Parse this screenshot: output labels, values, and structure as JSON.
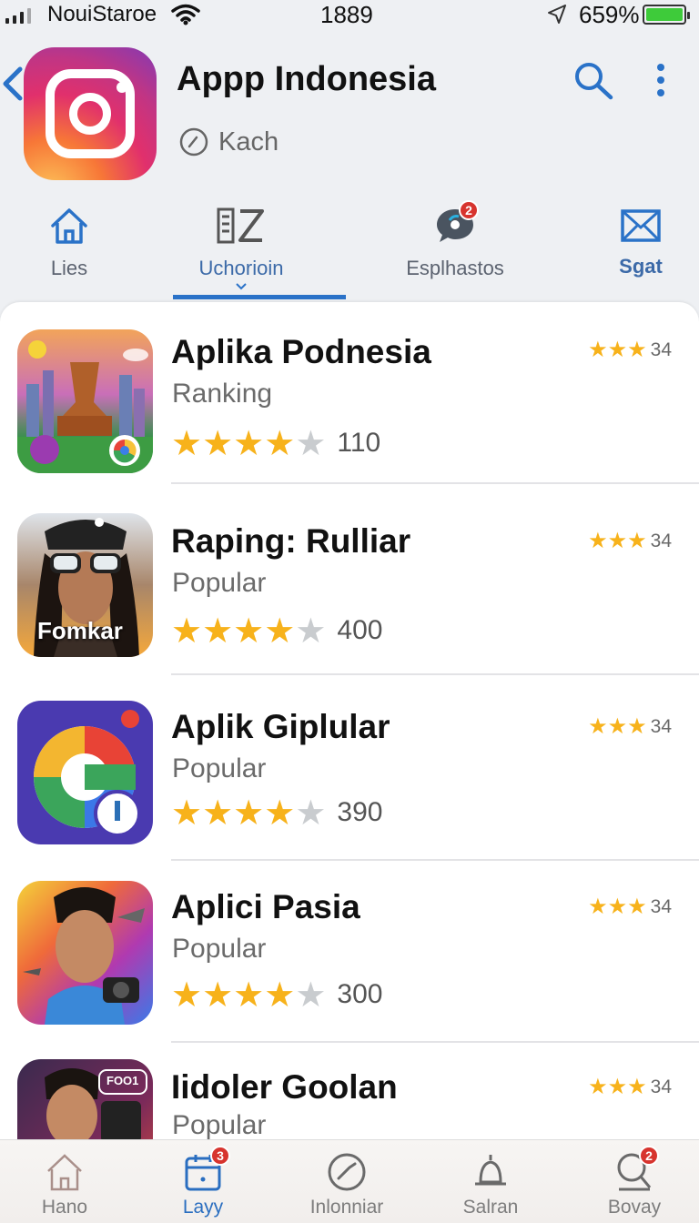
{
  "status_bar": {
    "carrier": "NouiStaroe",
    "time": "1889",
    "battery_percent": "659%",
    "battery_level": 1.0
  },
  "header": {
    "title": "Appp Indonesia",
    "subtitle": "Kach",
    "icons": [
      "back-chevron-icon",
      "app-logo-icon",
      "clock-icon",
      "search-icon",
      "more-vertical-icon"
    ]
  },
  "tabs": [
    {
      "label": "Lies",
      "icon": "home-icon",
      "active": false
    },
    {
      "label": "Uchorioin",
      "icon": "list-z-icon",
      "active": true
    },
    {
      "label": "Esplhastos",
      "icon": "chat-icon",
      "active": false,
      "badge": "2"
    },
    {
      "label": "Sgat",
      "icon": "mail-icon",
      "active": false
    }
  ],
  "apps": [
    {
      "title": "Aplika Podnesia",
      "subtitle": "Ranking",
      "rating": 4,
      "count": "110",
      "mini_rating": 3,
      "mini_count": "34"
    },
    {
      "title": "Raping: Rulliar",
      "subtitle": "Popular",
      "rating": 4,
      "count": "400",
      "mini_rating": 3,
      "mini_count": "34",
      "icon_caption": "Fomkar"
    },
    {
      "title": "Aplik Giplular",
      "subtitle": "Popular",
      "rating": 4,
      "count": "390",
      "mini_rating": 3,
      "mini_count": "34"
    },
    {
      "title": "Aplici Pasia",
      "subtitle": "Popular",
      "rating": 4,
      "count": "300",
      "mini_rating": 3,
      "mini_count": "34"
    },
    {
      "title": "Iidoler Goolan",
      "subtitle": "Popular",
      "mini_rating": 3,
      "mini_count": "34",
      "icon_caption": "FOO1"
    }
  ],
  "bottom_nav": [
    {
      "label": "Hano",
      "icon": "house-icon",
      "active": false
    },
    {
      "label": "Layy",
      "icon": "calendar-icon",
      "active": true,
      "badge": "3"
    },
    {
      "label": "Inlonniar",
      "icon": "compass-icon",
      "active": false
    },
    {
      "label": "Salran",
      "icon": "bell-icon",
      "active": false
    },
    {
      "label": "Bovay",
      "icon": "search-icon",
      "active": false,
      "badge": "2"
    }
  ],
  "colors": {
    "accent": "#2a72c8",
    "star": "#f7b21b",
    "badge": "#d7342e"
  }
}
